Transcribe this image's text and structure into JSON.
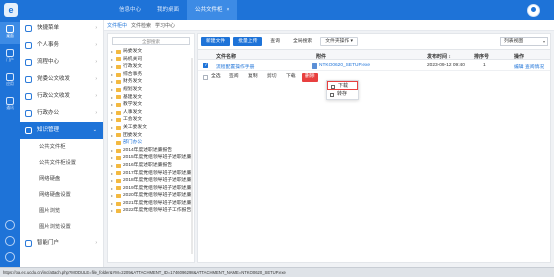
{
  "topbar": {
    "logo": "e",
    "tabs": [
      {
        "label": "信息中心",
        "active": false
      },
      {
        "label": "我的桌面",
        "active": false
      },
      {
        "label": "公共文件柜",
        "active": true
      }
    ],
    "close_glyph": "×"
  },
  "rail": [
    {
      "label": "桌面",
      "icon": "desktop-icon",
      "active": true
    },
    {
      "label": "门户",
      "icon": "portal-icon",
      "active": false
    },
    {
      "label": "应用",
      "icon": "apps-icon",
      "active": false
    },
    {
      "label": "通讯",
      "icon": "contacts-icon",
      "active": false
    }
  ],
  "sidenav": {
    "items": [
      {
        "label": "快捷菜单",
        "open": false
      },
      {
        "label": "个人事务",
        "open": false
      },
      {
        "label": "流程中心",
        "open": false
      },
      {
        "label": "党委公文收发",
        "open": false
      },
      {
        "label": "行政公文收发",
        "open": false
      },
      {
        "label": "行政办公",
        "open": false
      },
      {
        "label": "知识管理",
        "open": true
      }
    ],
    "subitems": [
      "公共文件柜",
      "公共文件柜设置",
      "网络硬盘",
      "网络硬盘设置",
      "图片浏览",
      "图片浏览设置"
    ],
    "bottom_item": "智能门户"
  },
  "breadcrumbs": [
    {
      "label": "文件柜中",
      "active": true
    },
    {
      "label": "文件检索",
      "active": false
    },
    {
      "label": "学习中心",
      "active": false
    }
  ],
  "tree": {
    "search_placeholder": "全部搜索",
    "rows": [
      {
        "label": "局委发文",
        "level": 1,
        "toggle": "▸",
        "selected": false
      },
      {
        "label": "局机关司",
        "level": 1,
        "toggle": "▸",
        "selected": false
      },
      {
        "label": "行政发文",
        "level": 1,
        "toggle": "▸",
        "selected": false
      },
      {
        "label": "综合事务",
        "level": 1,
        "toggle": "▸",
        "selected": false
      },
      {
        "label": "财务发文",
        "level": 1,
        "toggle": "▸",
        "selected": false
      },
      {
        "label": "规划发文",
        "level": 1,
        "toggle": "▸",
        "selected": false
      },
      {
        "label": "基建发文",
        "level": 1,
        "toggle": "▸",
        "selected": false
      },
      {
        "label": "教学发文",
        "level": 1,
        "toggle": "▸",
        "selected": false
      },
      {
        "label": "人事发文",
        "level": 1,
        "toggle": "▸",
        "selected": false
      },
      {
        "label": "工会发文",
        "level": 1,
        "toggle": "▸",
        "selected": false
      },
      {
        "label": "关工委发文",
        "level": 1,
        "toggle": "▸",
        "selected": false
      },
      {
        "label": "团委发文",
        "level": 1,
        "toggle": "▸",
        "selected": false
      },
      {
        "label": "部门办公",
        "level": 1,
        "toggle": "",
        "selected": true
      },
      {
        "label": "2014年度述职述廉报告",
        "level": 1,
        "toggle": "▸",
        "selected": false
      },
      {
        "label": "2015年度党组领导班子述职述廉",
        "level": 1,
        "toggle": "▸",
        "selected": false
      },
      {
        "label": "2016年度述职述廉报告",
        "level": 1,
        "toggle": "▸",
        "selected": false
      },
      {
        "label": "2017年度党组领导班子述职述廉",
        "level": 1,
        "toggle": "▸",
        "selected": false
      },
      {
        "label": "2018年度党组领导班子述职述廉",
        "level": 1,
        "toggle": "▸",
        "selected": false
      },
      {
        "label": "2019年度党组领导班子述职述廉",
        "level": 1,
        "toggle": "▸",
        "selected": false
      },
      {
        "label": "2020年度党组领导班子述职述廉",
        "level": 1,
        "toggle": "▸",
        "selected": false
      },
      {
        "label": "2021年度党组领导班子述职述廉",
        "level": 1,
        "toggle": "▸",
        "selected": false
      },
      {
        "label": "2022年度党组领导班子工作报告",
        "level": 1,
        "toggle": "▸",
        "selected": false
      }
    ]
  },
  "toolbar": {
    "buttons": [
      {
        "label": "新建文件",
        "style": "primary"
      },
      {
        "label": "批量上传",
        "style": "primary"
      },
      {
        "label": "查询",
        "style": "flat"
      },
      {
        "label": "全局搜索",
        "style": "flat"
      },
      {
        "label": "文件夹操作 ▾",
        "style": "default"
      }
    ],
    "sort_select": "列表视图"
  },
  "grid": {
    "columns": [
      "文件名称",
      "附件",
      "发布时间 ↕",
      "排序号",
      "操作"
    ],
    "rows": [
      {
        "checked": true,
        "name": "流程配置操作手册",
        "attachment": "NTKO0620_SETUP.exe",
        "time": "2023-09-12 09:40",
        "order": "1",
        "actions": [
          "编辑",
          "查阅情况"
        ]
      }
    ]
  },
  "footer": {
    "select_all": "全选",
    "buttons": [
      "签阅",
      "复制",
      "剪切",
      "下载"
    ],
    "delete": "删除"
  },
  "dropdown": {
    "items": [
      {
        "label": "下载",
        "icon": "download-icon",
        "highlight": true
      },
      {
        "label": "转存",
        "icon": "save-icon",
        "highlight": false
      }
    ]
  },
  "statusbar": {
    "url": "https://oa.ec.ucdu.cn/inc/attach.php?MODULE=file_folder&YM=2209&ATTACHMENT_ID=1746096298&ATTACHMENT_NAME=NTKO0620_SETUP.exe"
  }
}
